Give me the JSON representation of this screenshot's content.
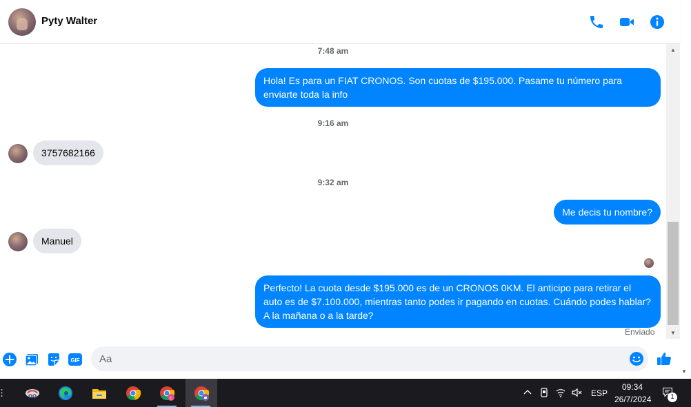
{
  "header": {
    "contact_name": "Pyty Walter",
    "icons": [
      "phone-icon",
      "video-camera-icon",
      "info-icon"
    ],
    "accent_color": "#0084ff"
  },
  "messages": {
    "ts1": "7:48 am",
    "out1": "Hola! Es para un FIAT CRONOS. Son cuotas de $195.000. Pasame tu número para enviarte toda la info",
    "ts2": "9:16 am",
    "in1": "3757682166",
    "ts3": "9:32 am",
    "out2": "Me decis tu nombre?",
    "in2": "Manuel",
    "out3": "Perfecto! La cuota desde $195.000 es de un CRONOS 0KM. El anticipo para retirar el auto es de $7.100.000, mientras tanto podes ir pagando en cuotas. Cuándo podes hablar? A la mañana o a la tarde?",
    "status": "Enviado"
  },
  "composer": {
    "placeholder": "Aa",
    "icons": [
      "plus-icon",
      "photo-icon",
      "sticker-icon",
      "gif-icon",
      "emoji-icon",
      "thumbs-up-icon"
    ],
    "gif_label": "GIF"
  },
  "taskbar": {
    "apps": [
      "snipping-tool-icon",
      "edge-icon",
      "file-explorer-icon",
      "chrome-icon",
      "chrome-profile-c-icon",
      "chrome-profile-locked-icon"
    ],
    "language": "ESP",
    "time": "09:34",
    "date": "26/7/2024",
    "notification_count": "1"
  }
}
